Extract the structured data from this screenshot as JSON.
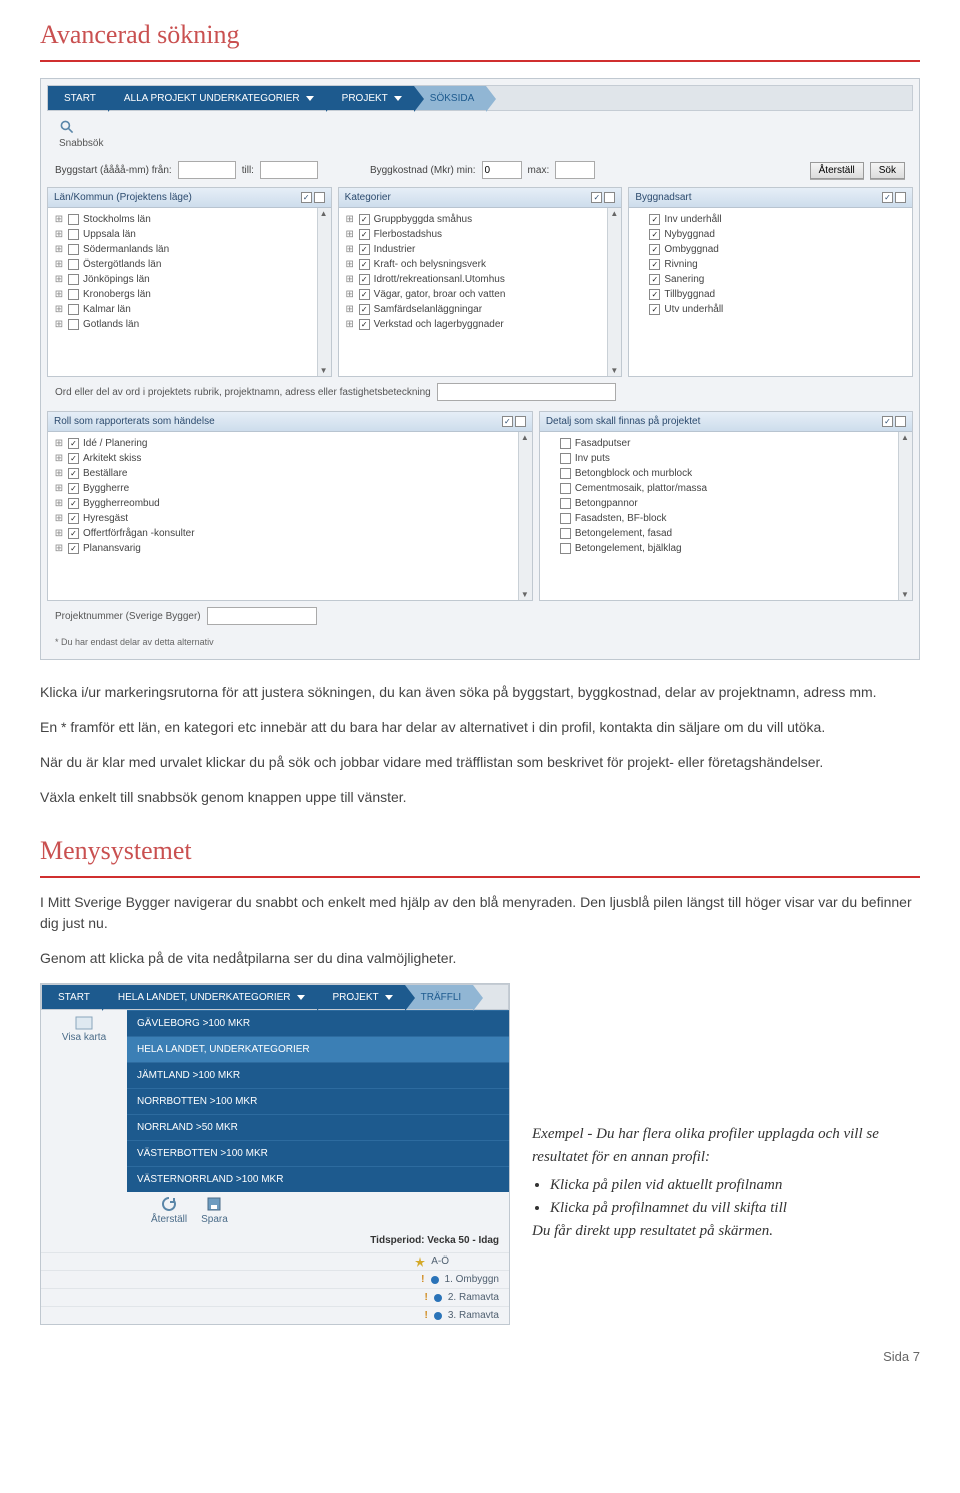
{
  "section1_title": "Avancerad sökning",
  "nav": {
    "start": "START",
    "allproj": "ALLA PROJEKT UNDERKATEGORIER",
    "projekt": "PROJEKT",
    "soksida": "SÖKSIDA"
  },
  "quicksearch_label": "Snabbsök",
  "filters": {
    "byggstart_label": "Byggstart (åååå-mm)  från:",
    "till_label": "till:",
    "byggkost_label": "Byggkostnad (Mkr)  min:",
    "byggkost_min": "0",
    "max_label": "max:",
    "reset": "Återställ",
    "search": "Sök"
  },
  "panels": {
    "lan": {
      "title": "Län/Kommun (Projektens läge)",
      "items": [
        "Stockholms län",
        "Uppsala län",
        "Södermanlands län",
        "Östergötlands län",
        "Jönköpings län",
        "Kronobergs län",
        "Kalmar län",
        "Gotlands län"
      ]
    },
    "kat": {
      "title": "Kategorier",
      "items": [
        "Gruppbyggda småhus",
        "Flerbostadshus",
        "Industrier",
        "Kraft- och belysningsverk",
        "Idrott/rekreationsanl.Utomhus",
        "Vägar, gator, broar och vatten",
        "Samfärdselanläggningar",
        "Verkstad och lagerbyggnader"
      ]
    },
    "bygg": {
      "title": "Byggnadsart",
      "items": [
        "Inv underhåll",
        "Nybyggnad",
        "Ombyggnad",
        "Rivning",
        "Sanering",
        "Tillbyggnad",
        "Utv underhåll"
      ]
    },
    "roll": {
      "title": "Roll som rapporterats som händelse",
      "items": [
        "Idé / Planering",
        "Arkitekt skiss",
        "Beställare",
        "Byggherre",
        "Byggherreombud",
        "Hyresgäst",
        "Offertförfrågan -konsulter",
        "Planansvarig"
      ]
    },
    "detalj": {
      "title": "Detalj som skall finnas på projektet",
      "items": [
        "Fasadputser",
        "Inv puts",
        "Betongblock och murblock",
        "Cementmosaik, plattor/massa",
        "Betongpannor",
        "Fasadsten, BF-block",
        "Betongelement, fasad",
        "Betongelement, bjälklag"
      ]
    }
  },
  "keyword_label": "Ord eller del av ord i projektets rubrik, projektnamn, adress eller fastighetsbeteckning",
  "projnr_label": "Projektnummer (Sverige Bygger)",
  "footnote": "*  Du har endast delar av detta alternativ",
  "body_paragraphs": {
    "p1": "Klicka i/ur markeringsrutorna för att justera sökningen, du kan även söka på byggstart, byggkostnad, delar av projektnamn, adress mm.",
    "p2": "En * framför ett län, en kategori etc innebär att du bara har delar av alternativet i din profil, kontakta din säljare om du vill utöka.",
    "p3": "När du är klar med urvalet klickar du på sök och jobbar vidare med träfflistan som beskrivet för projekt- eller företagshändelser.",
    "p4": "Växla enkelt till snabbsök genom knappen uppe till vänster."
  },
  "section2_title": "Menysystemet",
  "menusys": {
    "p1": "I Mitt Sverige Bygger navigerar du snabbt och enkelt med hjälp av den blå menyraden. Den ljusblå pilen längst till höger visar var du befinner dig just nu.",
    "p2": "Genom att klicka på de vita nedåtpilarna ser du dina valmöjligheter."
  },
  "nav2": {
    "start": "START",
    "hela": "HELA LANDET, UNDERKATEGORIER",
    "projekt": "PROJEKT",
    "traffl": "TRÄFFLI"
  },
  "dropdown": [
    "GÄVLEBORG >100 MKR",
    "HELA LANDET, UNDERKATEGORIER",
    "JÄMTLAND >100 MKR",
    "NORRBOTTEN >100 MKR",
    "NORRLAND >50 MKR",
    "VÄSTERBOTTEN >100 MKR",
    "VÄSTERNORRLAND >100 MKR"
  ],
  "toolbar": {
    "visakarta": "Visa karta",
    "aterstall": "Återställ",
    "spara": "Spara"
  },
  "tidsperiod_label": "Tidsperiod: Vecka 50 - Idag",
  "results": {
    "ao": "A-Ö",
    "r1": "1. Ombyggn",
    "r2": "2. Ramavta",
    "r3": "3. Ramavta"
  },
  "example": {
    "title": "Exempel - Du har flera olika profiler upplagda och vill se resultatet för en annan profil:",
    "b1": "Klicka på pilen vid aktuellt profilnamn",
    "b2": "Klicka på profilnamnet du vill skifta till",
    "tail": "Du får direkt upp resultatet på skärmen."
  },
  "page_footer": "Sida 7"
}
